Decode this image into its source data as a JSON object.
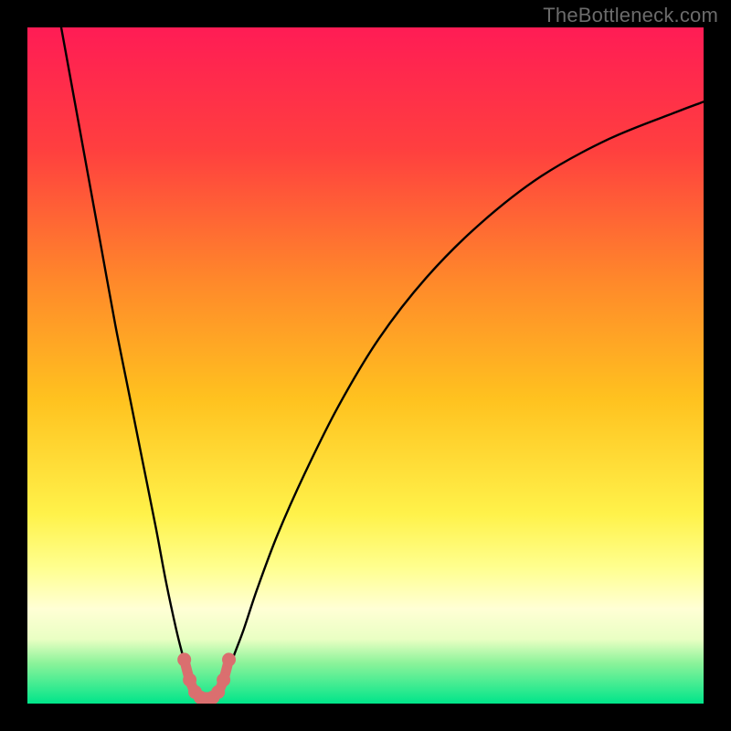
{
  "watermark": "TheBottleneck.com",
  "chart_data": {
    "type": "line",
    "title": "",
    "xlabel": "",
    "ylabel": "",
    "xlim": [
      0,
      100
    ],
    "ylim": [
      0,
      100
    ],
    "grid": false,
    "legend": false,
    "background_gradient": {
      "stops": [
        {
          "offset": 0.0,
          "color": "#ff1c55"
        },
        {
          "offset": 0.18,
          "color": "#ff3f3f"
        },
        {
          "offset": 0.38,
          "color": "#ff8a2a"
        },
        {
          "offset": 0.55,
          "color": "#ffc21f"
        },
        {
          "offset": 0.72,
          "color": "#fff24a"
        },
        {
          "offset": 0.8,
          "color": "#ffff90"
        },
        {
          "offset": 0.86,
          "color": "#ffffd5"
        },
        {
          "offset": 0.905,
          "color": "#e9ffc3"
        },
        {
          "offset": 0.94,
          "color": "#8cf39a"
        },
        {
          "offset": 1.0,
          "color": "#00e58a"
        }
      ]
    },
    "series": [
      {
        "name": "curve-left",
        "x": [
          5,
          7,
          9,
          11,
          13,
          15,
          17,
          19,
          20.5,
          22,
          23,
          23.8,
          24.5,
          25
        ],
        "y": [
          100,
          89,
          78,
          67,
          56,
          46,
          36,
          26,
          18,
          11,
          7,
          4,
          2,
          0.8
        ]
      },
      {
        "name": "curve-right",
        "x": [
          28,
          28.7,
          29.5,
          30.5,
          32,
          34,
          37,
          41,
          46,
          52,
          59,
          67,
          76,
          86,
          96,
          100
        ],
        "y": [
          0.8,
          2,
          4,
          7,
          11,
          17,
          25,
          34,
          44,
          54,
          63,
          71,
          78,
          83.5,
          87.5,
          89
        ]
      },
      {
        "name": "valley-marker",
        "marker": true,
        "color": "#da6f6f",
        "x": [
          23.2,
          24.0,
          24.8,
          25.6,
          26.5,
          27.4,
          28.2,
          29.0,
          29.8
        ],
        "y": [
          6.5,
          3.5,
          1.7,
          0.9,
          0.7,
          0.9,
          1.7,
          3.5,
          6.5
        ]
      }
    ]
  }
}
